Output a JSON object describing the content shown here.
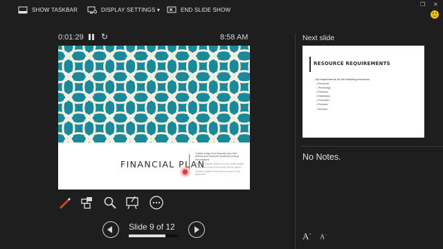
{
  "topbar": {
    "show_taskbar": "SHOW TASKBAR",
    "display_settings": "DISPLAY SETTINGS ▾",
    "end_slide_show": "END SLIDE SHOW"
  },
  "timer": {
    "elapsed": "0:01:29",
    "clock": "8:58 AM"
  },
  "current_slide": {
    "title": "FINANCIAL PLAN",
    "pattern_color": "#1a8a9a",
    "side_text": [
      "Outline a high-level financial plan that defines your financial model and pricing assumptions.",
      "You can include details on your initial capital needs, and how those funds will be spent.",
      "Include detailed financial forecasts in the appendix."
    ]
  },
  "navigation": {
    "slide_counter": "Slide 9 of 12",
    "progress": 0.75
  },
  "next_slide": {
    "label": "Next slide",
    "title": "RESOURCE REQUIREMENTS",
    "intro": "List requirements for the following resources:",
    "items": [
      "Personnel",
      "Technology",
      "Finances",
      "Distribution",
      "Promotion",
      "Products",
      "Services"
    ]
  },
  "notes": {
    "text": "No Notes."
  },
  "icons": [
    "taskbar-icon",
    "display-icon",
    "end-show-icon",
    "pen-icon",
    "slide-grid-icon",
    "zoom-icon",
    "pointer-icon",
    "more-icon",
    "increase-font-icon",
    "decrease-font-icon"
  ],
  "colors": {
    "background": "#1e1e1e",
    "pen": "#d24726",
    "accent": "#d24726"
  }
}
